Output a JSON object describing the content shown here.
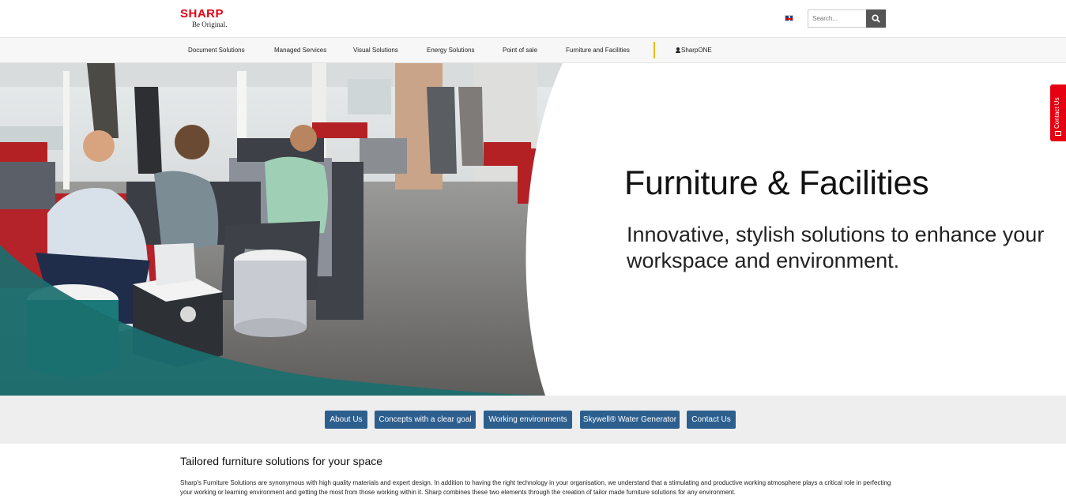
{
  "header": {
    "logo_brand": "SHARP",
    "logo_tagline": "Be Original.",
    "search_placeholder": "Search...",
    "language_flag": "uk-flag-icon",
    "search_icon": "search-icon"
  },
  "nav": {
    "items": [
      {
        "label": "Document Solutions"
      },
      {
        "label": "Managed Services"
      },
      {
        "label": "Visual Solutions"
      },
      {
        "label": "Energy Solutions"
      },
      {
        "label": "Point of sale"
      },
      {
        "label": "Furniture and Facilities"
      },
      {
        "label": "SharpONE",
        "icon": "user-icon"
      }
    ]
  },
  "hero": {
    "title": "Furniture & Facilities",
    "subtitle": "Innovative, stylish solutions to enhance your workspace and environment."
  },
  "contact_tab": {
    "label": "Contact Us",
    "icon": "envelope-icon"
  },
  "subnav": {
    "buttons": [
      {
        "label": "About Us"
      },
      {
        "label": "Concepts with a clear goal"
      },
      {
        "label": "Working environments"
      },
      {
        "label": "Skywell® Water Generator"
      },
      {
        "label": "Contact Us"
      }
    ]
  },
  "content": {
    "heading": "Tailored furniture solutions for your space",
    "body": "Sharp's Furniture Solutions are synonymous with high quality materials and expert design. In addition to having the right technology in your organisation, we understand that a stimulating and productive working atmosphere plays a critical role in perfecting your working or learning environment and getting the most from those working within it. Sharp combines these two elements through the creation of tailor made furniture solutions for any environment."
  },
  "colors": {
    "brand_red": "#e60012",
    "button_blue": "#2d5f8e",
    "nav_divider": "#f2b800",
    "teal_accent": "#1b7a79"
  }
}
